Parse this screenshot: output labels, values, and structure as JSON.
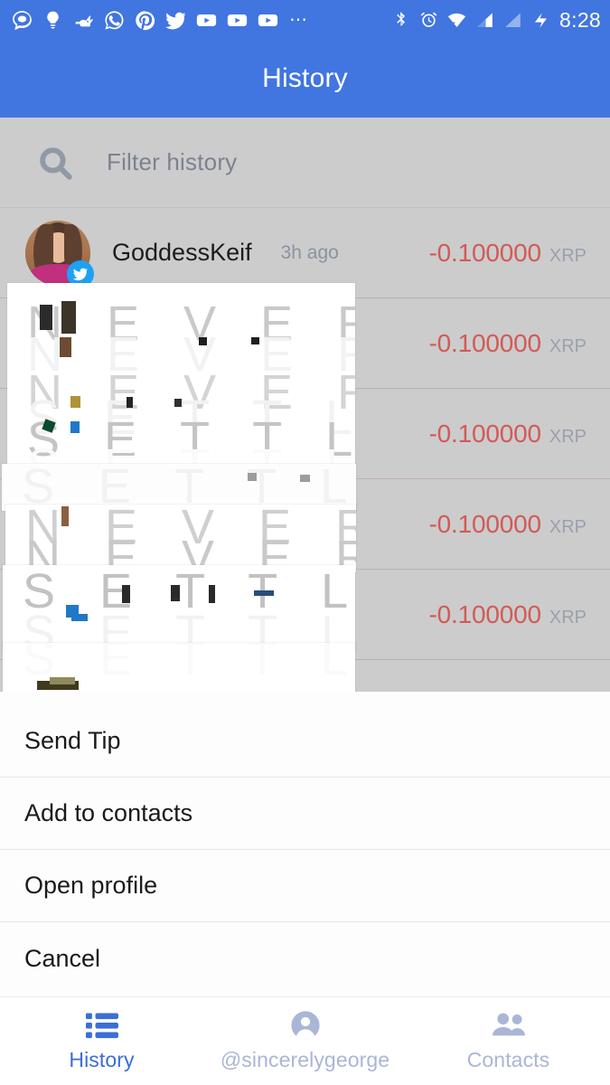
{
  "status_bar": {
    "clock": "8:28",
    "left_icons": [
      "signal-messenger-icon",
      "lightbulb-icon",
      "rabbit-icon",
      "whatsapp-icon",
      "pinterest-icon",
      "twitter-icon",
      "youtube-icon",
      "youtube-icon",
      "youtube-icon",
      "more-notifications-icon"
    ],
    "right_icons": [
      "bluetooth-icon",
      "alarm-clock-icon",
      "wifi-icon",
      "cell-signal-icon",
      "cell-signal-off-icon",
      "charging-bolt-icon"
    ]
  },
  "app_bar": {
    "title": "History"
  },
  "filter": {
    "icon": "search-icon",
    "placeholder": "Filter history",
    "value": ""
  },
  "history": {
    "rows": [
      {
        "name": "GoddessKeif",
        "time": "3h ago",
        "amount": "-0.100000",
        "currency": "XRP",
        "platform": "twitter"
      },
      {
        "name": "",
        "time": "",
        "amount": "-0.100000",
        "currency": "XRP",
        "platform": "twitter"
      },
      {
        "name": "",
        "time": "",
        "amount": "-0.100000",
        "currency": "XRP",
        "platform": "twitter"
      },
      {
        "name": "",
        "time": "",
        "amount": "-0.100000",
        "currency": "XRP",
        "platform": "twitter"
      },
      {
        "name": "",
        "time": "",
        "amount": "-0.100000",
        "currency": "XRP",
        "platform": "twitter"
      }
    ]
  },
  "glitch_overlay": {
    "line_a": "N E V E R",
    "line_b": "S E T T L E"
  },
  "bottom_sheet": {
    "items": [
      {
        "label": "Send Tip"
      },
      {
        "label": "Add to contacts"
      },
      {
        "label": "Open profile"
      },
      {
        "label": "Cancel"
      }
    ]
  },
  "bottom_nav": {
    "items": [
      {
        "label": "History",
        "icon": "list-icon",
        "state": "active"
      },
      {
        "label": "@sincerelygeorge",
        "icon": "person-icon",
        "state": "inactive"
      },
      {
        "label": "Contacts",
        "icon": "people-icon",
        "state": "inactive"
      }
    ]
  },
  "colors": {
    "brand_blue": "#4175e0",
    "nav_active": "#3b6fd4",
    "nav_inactive": "#aab6d6",
    "amount_negative": "#d25a56",
    "scrim": "#cccccc",
    "twitter_blue": "#1da1f2"
  }
}
